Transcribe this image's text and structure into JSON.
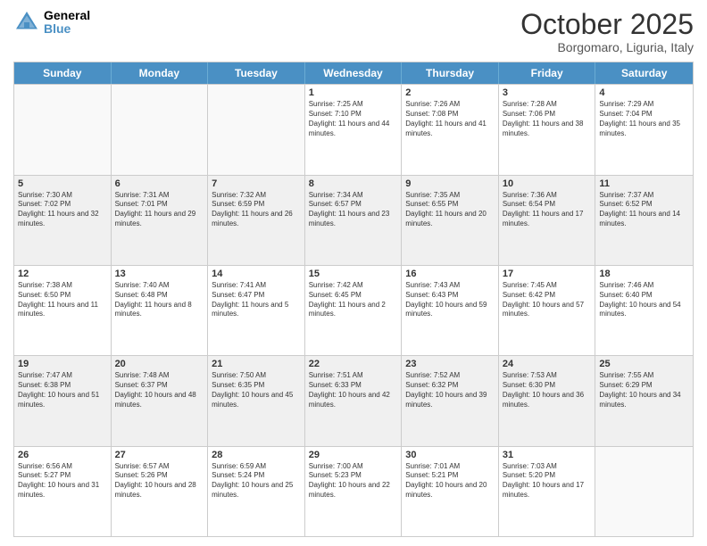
{
  "header": {
    "logo_line1": "General",
    "logo_line2": "Blue",
    "title": "October 2025",
    "subtitle": "Borgomaro, Liguria, Italy"
  },
  "days_of_week": [
    "Sunday",
    "Monday",
    "Tuesday",
    "Wednesday",
    "Thursday",
    "Friday",
    "Saturday"
  ],
  "weeks": [
    [
      {
        "day": "",
        "sunrise": "",
        "sunset": "",
        "daylight": ""
      },
      {
        "day": "",
        "sunrise": "",
        "sunset": "",
        "daylight": ""
      },
      {
        "day": "",
        "sunrise": "",
        "sunset": "",
        "daylight": ""
      },
      {
        "day": "1",
        "sunrise": "Sunrise: 7:25 AM",
        "sunset": "Sunset: 7:10 PM",
        "daylight": "Daylight: 11 hours and 44 minutes."
      },
      {
        "day": "2",
        "sunrise": "Sunrise: 7:26 AM",
        "sunset": "Sunset: 7:08 PM",
        "daylight": "Daylight: 11 hours and 41 minutes."
      },
      {
        "day": "3",
        "sunrise": "Sunrise: 7:28 AM",
        "sunset": "Sunset: 7:06 PM",
        "daylight": "Daylight: 11 hours and 38 minutes."
      },
      {
        "day": "4",
        "sunrise": "Sunrise: 7:29 AM",
        "sunset": "Sunset: 7:04 PM",
        "daylight": "Daylight: 11 hours and 35 minutes."
      }
    ],
    [
      {
        "day": "5",
        "sunrise": "Sunrise: 7:30 AM",
        "sunset": "Sunset: 7:02 PM",
        "daylight": "Daylight: 11 hours and 32 minutes."
      },
      {
        "day": "6",
        "sunrise": "Sunrise: 7:31 AM",
        "sunset": "Sunset: 7:01 PM",
        "daylight": "Daylight: 11 hours and 29 minutes."
      },
      {
        "day": "7",
        "sunrise": "Sunrise: 7:32 AM",
        "sunset": "Sunset: 6:59 PM",
        "daylight": "Daylight: 11 hours and 26 minutes."
      },
      {
        "day": "8",
        "sunrise": "Sunrise: 7:34 AM",
        "sunset": "Sunset: 6:57 PM",
        "daylight": "Daylight: 11 hours and 23 minutes."
      },
      {
        "day": "9",
        "sunrise": "Sunrise: 7:35 AM",
        "sunset": "Sunset: 6:55 PM",
        "daylight": "Daylight: 11 hours and 20 minutes."
      },
      {
        "day": "10",
        "sunrise": "Sunrise: 7:36 AM",
        "sunset": "Sunset: 6:54 PM",
        "daylight": "Daylight: 11 hours and 17 minutes."
      },
      {
        "day": "11",
        "sunrise": "Sunrise: 7:37 AM",
        "sunset": "Sunset: 6:52 PM",
        "daylight": "Daylight: 11 hours and 14 minutes."
      }
    ],
    [
      {
        "day": "12",
        "sunrise": "Sunrise: 7:38 AM",
        "sunset": "Sunset: 6:50 PM",
        "daylight": "Daylight: 11 hours and 11 minutes."
      },
      {
        "day": "13",
        "sunrise": "Sunrise: 7:40 AM",
        "sunset": "Sunset: 6:48 PM",
        "daylight": "Daylight: 11 hours and 8 minutes."
      },
      {
        "day": "14",
        "sunrise": "Sunrise: 7:41 AM",
        "sunset": "Sunset: 6:47 PM",
        "daylight": "Daylight: 11 hours and 5 minutes."
      },
      {
        "day": "15",
        "sunrise": "Sunrise: 7:42 AM",
        "sunset": "Sunset: 6:45 PM",
        "daylight": "Daylight: 11 hours and 2 minutes."
      },
      {
        "day": "16",
        "sunrise": "Sunrise: 7:43 AM",
        "sunset": "Sunset: 6:43 PM",
        "daylight": "Daylight: 10 hours and 59 minutes."
      },
      {
        "day": "17",
        "sunrise": "Sunrise: 7:45 AM",
        "sunset": "Sunset: 6:42 PM",
        "daylight": "Daylight: 10 hours and 57 minutes."
      },
      {
        "day": "18",
        "sunrise": "Sunrise: 7:46 AM",
        "sunset": "Sunset: 6:40 PM",
        "daylight": "Daylight: 10 hours and 54 minutes."
      }
    ],
    [
      {
        "day": "19",
        "sunrise": "Sunrise: 7:47 AM",
        "sunset": "Sunset: 6:38 PM",
        "daylight": "Daylight: 10 hours and 51 minutes."
      },
      {
        "day": "20",
        "sunrise": "Sunrise: 7:48 AM",
        "sunset": "Sunset: 6:37 PM",
        "daylight": "Daylight: 10 hours and 48 minutes."
      },
      {
        "day": "21",
        "sunrise": "Sunrise: 7:50 AM",
        "sunset": "Sunset: 6:35 PM",
        "daylight": "Daylight: 10 hours and 45 minutes."
      },
      {
        "day": "22",
        "sunrise": "Sunrise: 7:51 AM",
        "sunset": "Sunset: 6:33 PM",
        "daylight": "Daylight: 10 hours and 42 minutes."
      },
      {
        "day": "23",
        "sunrise": "Sunrise: 7:52 AM",
        "sunset": "Sunset: 6:32 PM",
        "daylight": "Daylight: 10 hours and 39 minutes."
      },
      {
        "day": "24",
        "sunrise": "Sunrise: 7:53 AM",
        "sunset": "Sunset: 6:30 PM",
        "daylight": "Daylight: 10 hours and 36 minutes."
      },
      {
        "day": "25",
        "sunrise": "Sunrise: 7:55 AM",
        "sunset": "Sunset: 6:29 PM",
        "daylight": "Daylight: 10 hours and 34 minutes."
      }
    ],
    [
      {
        "day": "26",
        "sunrise": "Sunrise: 6:56 AM",
        "sunset": "Sunset: 5:27 PM",
        "daylight": "Daylight: 10 hours and 31 minutes."
      },
      {
        "day": "27",
        "sunrise": "Sunrise: 6:57 AM",
        "sunset": "Sunset: 5:26 PM",
        "daylight": "Daylight: 10 hours and 28 minutes."
      },
      {
        "day": "28",
        "sunrise": "Sunrise: 6:59 AM",
        "sunset": "Sunset: 5:24 PM",
        "daylight": "Daylight: 10 hours and 25 minutes."
      },
      {
        "day": "29",
        "sunrise": "Sunrise: 7:00 AM",
        "sunset": "Sunset: 5:23 PM",
        "daylight": "Daylight: 10 hours and 22 minutes."
      },
      {
        "day": "30",
        "sunrise": "Sunrise: 7:01 AM",
        "sunset": "Sunset: 5:21 PM",
        "daylight": "Daylight: 10 hours and 20 minutes."
      },
      {
        "day": "31",
        "sunrise": "Sunrise: 7:03 AM",
        "sunset": "Sunset: 5:20 PM",
        "daylight": "Daylight: 10 hours and 17 minutes."
      },
      {
        "day": "",
        "sunrise": "",
        "sunset": "",
        "daylight": ""
      }
    ]
  ]
}
